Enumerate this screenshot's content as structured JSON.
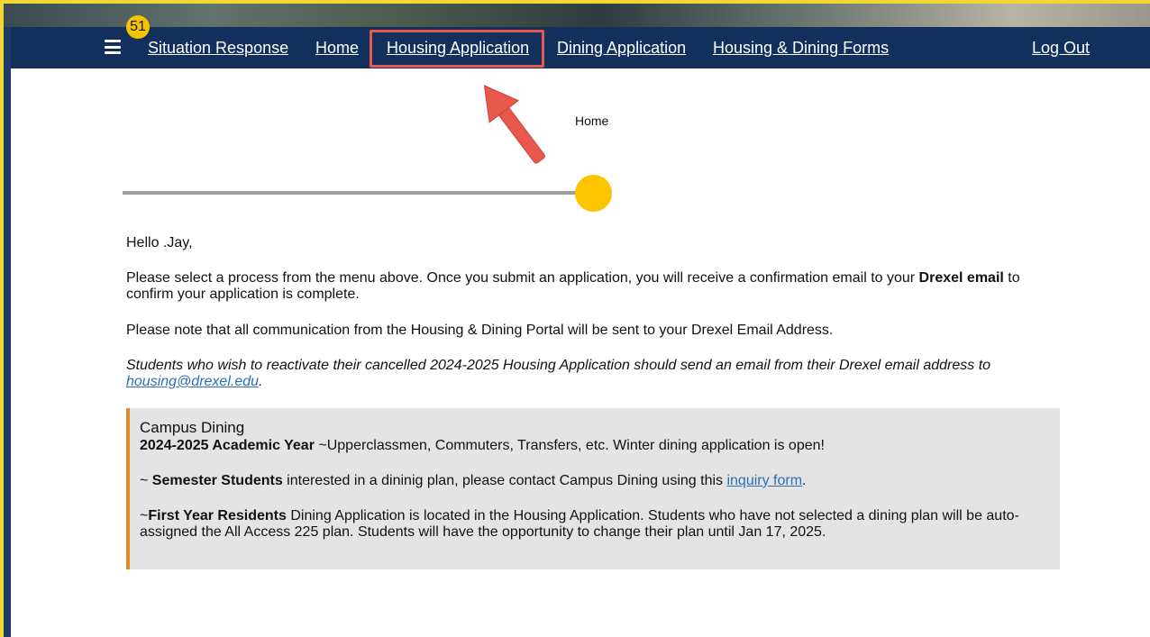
{
  "nav": {
    "badge_count": "51",
    "situation_response": "Situation Response",
    "home": "Home",
    "housing_application": "Housing Application",
    "dining_application": "Dining Application",
    "housing_dining_forms": "Housing & Dining Forms",
    "log_out": "Log Out"
  },
  "breadcrumb": {
    "current": "Home"
  },
  "progress": {
    "fraction": 1.0
  },
  "main": {
    "greeting": "Hello .Jay,",
    "p1_before": "Please select a process from the menu above. Once you submit an application, you will receive a confirmation email to your ",
    "p1_bold": "Drexel email",
    "p1_after": " to",
    "p1_line2": "confirm your application is complete.",
    "p2": "Please note that all communication from the Housing & Dining Portal will be sent to your Drexel Email Address.",
    "p3": "Students who wish to reactivate their cancelled 2024-2025 Housing Application should send an email from their Drexel email address to",
    "p3_email": "housing@drexel.edu",
    "p3_end": "."
  },
  "dining": {
    "title": "Campus Dining",
    "line1_bold": "2024-2025 Academic Year",
    "line1_rest": " ~Upperclassmen, Commuters, Transfers, etc. Winter dining application is open!",
    "line2_prefix": "~ ",
    "line2_bold": "Semester Students",
    "line2_rest": " interested in a dininig plan, please contact Campus Dining using this ",
    "line2_link": "inquiry form",
    "line2_end": ".",
    "line3_prefix": "~",
    "line3_bold": "First Year Residents",
    "line3_rest": " Dining Application is located in the Housing Application. Students who have not selected a dining plan will be auto-",
    "line3_line2": "assigned the All Access 225 plan. Students will have the opportunity to change their plan until Jan 17, 2025."
  },
  "colors": {
    "navbar": "#13305c",
    "frame_border": "#f2d634",
    "highlight": "#e8584c",
    "progress_dot": "#fbc600",
    "dining_accent": "#e2892a",
    "link": "#2a6fb4"
  }
}
